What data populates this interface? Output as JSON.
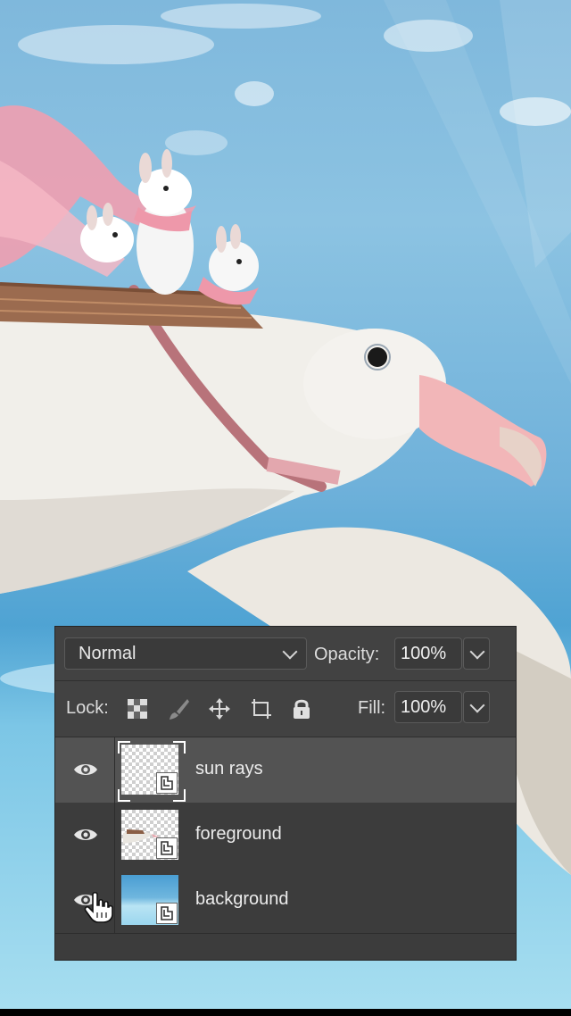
{
  "layers_panel": {
    "blend_mode": "Normal",
    "opacity_label": "Opacity:",
    "opacity_value": "100%",
    "lock_label": "Lock:",
    "fill_label": "Fill:",
    "fill_value": "100%",
    "lock_icons": [
      "lock-transparent-pixels-icon",
      "lock-image-pixels-icon",
      "lock-position-icon",
      "lock-artboard-icon",
      "lock-all-icon"
    ],
    "layers": [
      {
        "name": "sun rays",
        "visible": true,
        "selected": true,
        "thumbnail": "transparent-checker",
        "smart_object": true
      },
      {
        "name": "foreground",
        "visible": true,
        "selected": false,
        "thumbnail": "bird-on-transparent",
        "smart_object": true
      },
      {
        "name": "background",
        "visible": true,
        "selected": false,
        "thumbnail": "sky",
        "smart_object": true
      }
    ]
  },
  "colors": {
    "panel_bg": "#3c3c3c",
    "selected_layer_bg": "#535353",
    "sky": "#6fb1da"
  }
}
